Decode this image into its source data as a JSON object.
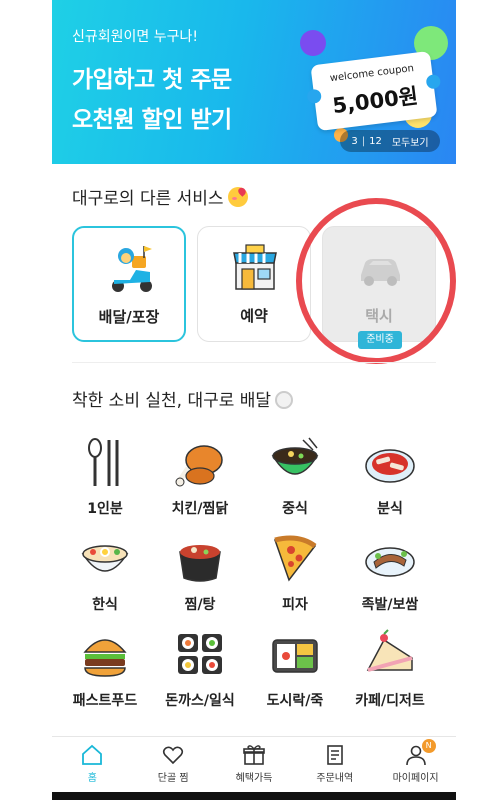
{
  "banner": {
    "subtitle": "신규회원이면 누구나!",
    "line1": "가입하고 첫 주문",
    "line2": "오천원 할인 받기",
    "coupon_title": "welcome coupon",
    "coupon_value": "5,000원",
    "pager_current": "3",
    "pager_sep": "|",
    "pager_total": "12",
    "pager_all": "모두보기"
  },
  "services": {
    "title": "대구로의 다른 서비스",
    "items": [
      {
        "label": "배달/포장",
        "icon": "scooter-icon"
      },
      {
        "label": "예약",
        "icon": "store-icon"
      },
      {
        "label": "택시",
        "icon": "car-icon",
        "badge": "준비중"
      }
    ]
  },
  "categories": {
    "title": "착한 소비 실천, 대구로 배달",
    "items": [
      {
        "label": "1인분",
        "icon": "spoon-chopsticks-icon"
      },
      {
        "label": "치킨/찜닭",
        "icon": "chicken-icon"
      },
      {
        "label": "중식",
        "icon": "noodle-bowl-icon"
      },
      {
        "label": "분식",
        "icon": "tteokbokki-icon"
      },
      {
        "label": "한식",
        "icon": "bibimbap-icon"
      },
      {
        "label": "찜/탕",
        "icon": "stew-pot-icon"
      },
      {
        "label": "피자",
        "icon": "pizza-icon"
      },
      {
        "label": "족발/보쌈",
        "icon": "jokbal-icon"
      },
      {
        "label": "패스트푸드",
        "icon": "burger-icon"
      },
      {
        "label": "돈까스/일식",
        "icon": "sushi-icon"
      },
      {
        "label": "도시락/죽",
        "icon": "lunchbox-icon"
      },
      {
        "label": "카페/디저트",
        "icon": "cake-icon"
      }
    ]
  },
  "nav": {
    "items": [
      {
        "label": "홈",
        "icon": "home-icon"
      },
      {
        "label": "단골 찜",
        "icon": "heart-icon"
      },
      {
        "label": "혜택가득",
        "icon": "gift-icon"
      },
      {
        "label": "주문내역",
        "icon": "receipt-icon"
      },
      {
        "label": "마이페이지",
        "icon": "person-icon",
        "badge": "N"
      }
    ]
  },
  "colors": {
    "accent": "#2bc4dd",
    "highlight_circle": "#e94a50",
    "badge": "#2fb5d8",
    "nav_badge": "#f39a2b"
  }
}
